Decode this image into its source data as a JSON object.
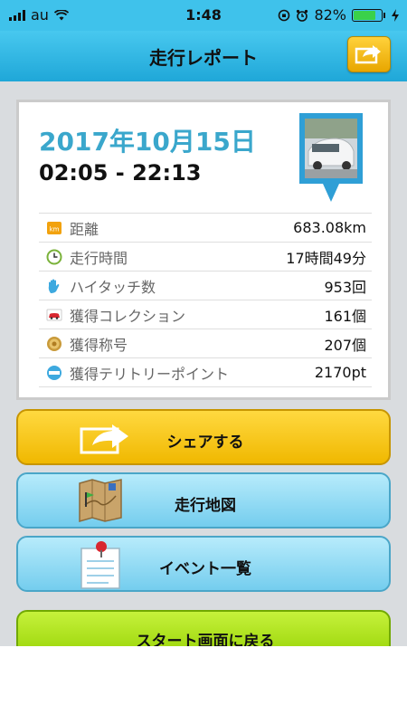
{
  "status_bar": {
    "carrier": "au",
    "time": "1:48",
    "battery_percent": "82%",
    "battery_level": 0.82
  },
  "nav": {
    "title": "走行レポート"
  },
  "report": {
    "date": "2017年10月15日",
    "time_range": "02:05 - 22:13",
    "stats": [
      {
        "icon": "km-badge-icon",
        "label": "距離",
        "value": "683.08km"
      },
      {
        "icon": "clock-icon",
        "label": "走行時間",
        "value": "17時間49分"
      },
      {
        "icon": "hand-icon",
        "label": "ハイタッチ数",
        "value": "953回"
      },
      {
        "icon": "car-icon",
        "label": "獲得コレクション",
        "value": "161個"
      },
      {
        "icon": "medal-icon",
        "label": "獲得称号",
        "value": "207個"
      },
      {
        "icon": "spot-icon",
        "label": "獲得テリトリーポイント",
        "value": "2170pt"
      }
    ]
  },
  "buttons": {
    "share": "シェアする",
    "map": "走行地図",
    "events": "イベント一覧",
    "start": "スタート画面に戻る"
  },
  "colors": {
    "header": "#3fc2eb",
    "date_text": "#3aa7cc",
    "share_button": "#ffd940",
    "blue_button": "#8fd8f3",
    "green_button": "#b4e61f"
  }
}
